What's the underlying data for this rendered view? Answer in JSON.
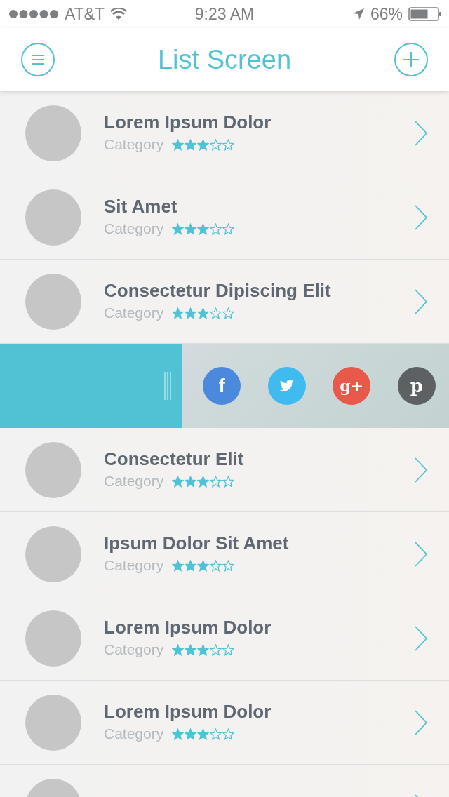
{
  "status_bar": {
    "carrier": "AT&T",
    "time": "9:23 AM",
    "battery": "66%"
  },
  "nav": {
    "title": "List Screen"
  },
  "items": [
    {
      "kind": "row",
      "title": "Lorem Ipsum Dolor",
      "category": "Category",
      "stars": 3
    },
    {
      "kind": "row",
      "title": "Sit Amet",
      "category": "Category",
      "stars": 3
    },
    {
      "kind": "row",
      "title": "Consectetur Dipiscing Elit",
      "category": "Category",
      "stars": 3
    },
    {
      "kind": "share",
      "buttons": [
        {
          "kind": "facebook",
          "label": "f",
          "color": "#4a89dc"
        },
        {
          "kind": "twitter",
          "color": "#40bbf0"
        },
        {
          "kind": "google",
          "label": "g+",
          "color": "#e9594b"
        },
        {
          "kind": "pinterest",
          "label": "p",
          "color": "#5e6164"
        }
      ]
    },
    {
      "kind": "row",
      "title": "Consectetur Elit",
      "category": "Category",
      "stars": 3
    },
    {
      "kind": "row",
      "title": "Ipsum Dolor Sit Amet",
      "category": "Category",
      "stars": 3
    },
    {
      "kind": "row",
      "title": "Lorem Ipsum Dolor",
      "category": "Category",
      "stars": 3
    },
    {
      "kind": "row",
      "title": "Lorem Ipsum Dolor",
      "category": "Category",
      "stars": 3
    },
    {
      "kind": "row"
    }
  ]
}
